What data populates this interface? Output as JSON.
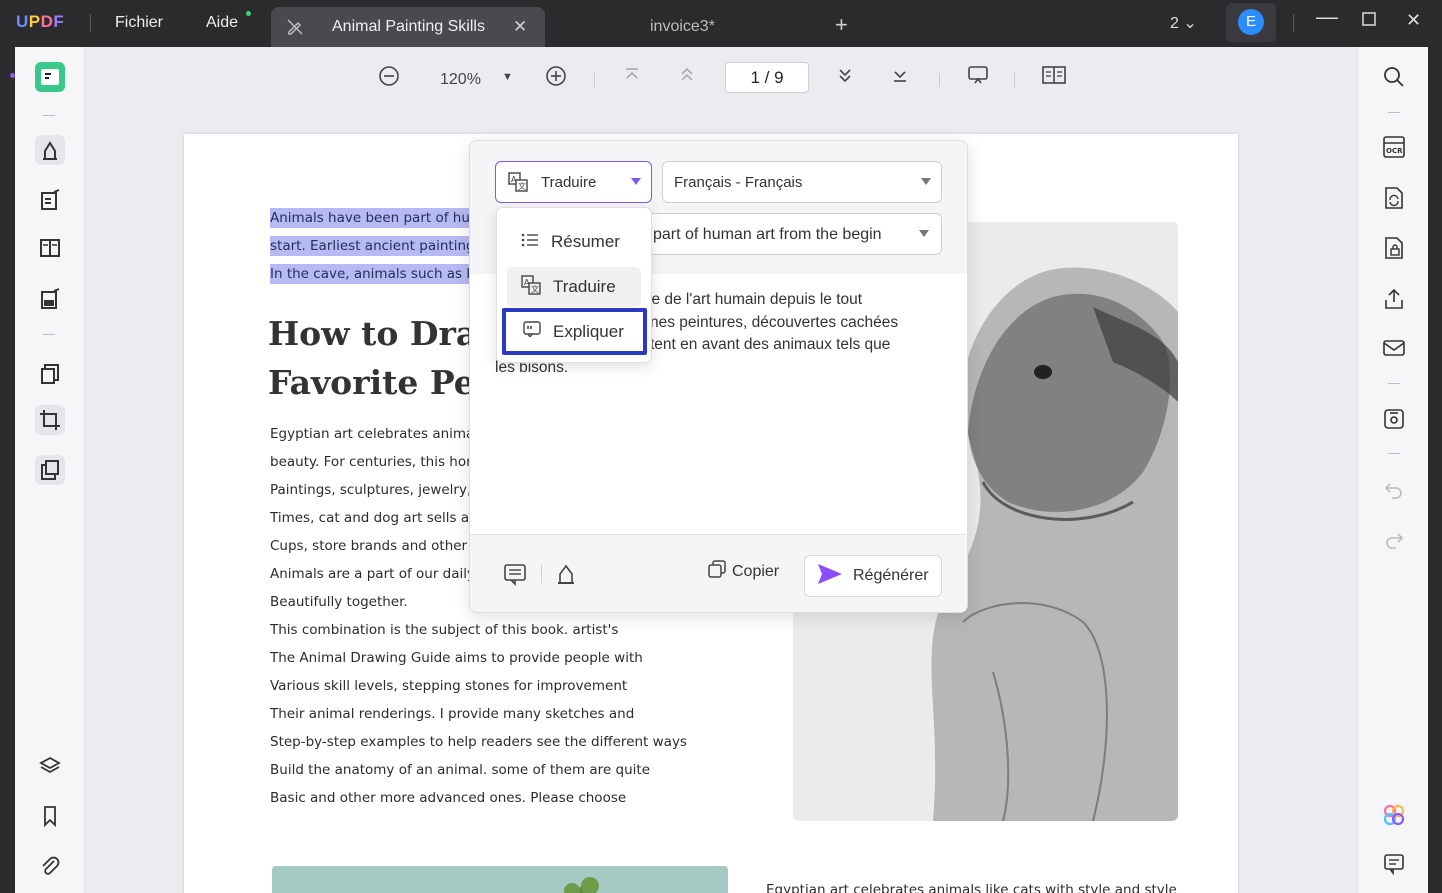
{
  "app": {
    "logo": "UPDF",
    "menu_file": "Fichier",
    "menu_help": "Aide",
    "active_tab": "Animal Painting Skills",
    "inactive_tab": "invoice3*",
    "window_count": "2",
    "user_initial": "E"
  },
  "viewbar": {
    "zoom": "120%",
    "page_current": "1",
    "page_total": "9",
    "page_display": "1 / 9"
  },
  "document": {
    "highlighted_lines": [
      "Animals have been part of hur",
      "start. Earliest ancient painting",
      "In the cave, animals such as b"
    ],
    "heading_lines": [
      "How to Draw",
      "Favorite Pet"
    ],
    "body_lines": [
      "Egyptian art celebrates anima",
      "beauty. For centuries, this hor",
      "Paintings, sculptures, jewelry,",
      "Times, cat and dog art sells a",
      "Cups, store brands and other i",
      "Animals are a part of our daily",
      "Beautifully together.",
      "This combination is the subject of this book. artist's",
      "The Animal Drawing Guide aims to provide people with",
      "Various skill levels, stepping stones for improvement",
      "Their animal renderings. I provide many sketches and",
      "Step-by-step examples to help readers see the different ways",
      "Build the anatomy of an animal. some of them are quite",
      "Basic and other more advanced ones. Please choose"
    ],
    "bottom_text": "Egyptian art celebrates animals like cats with style and style"
  },
  "ai_popup": {
    "action_selected": "Traduire",
    "language_selected": "Français - Français",
    "source_text": "part of human art from the begin",
    "result_lines": [
      "ie de l'art humain depuis le tout",
      "nes peintures, découvertes cachées",
      "tent en avant des animaux tels que",
      "les bisons."
    ],
    "copy_label": "Copier",
    "regenerate_label": "Régénérer",
    "dropdown_items": [
      "Résumer",
      "Traduire",
      "Expliquer"
    ]
  },
  "colors": {
    "accent_purple": "#7a5cf0",
    "highlight": "#b7b9f2",
    "focus_border": "#2b3ac2",
    "avatar_blue": "#2d8cff"
  }
}
